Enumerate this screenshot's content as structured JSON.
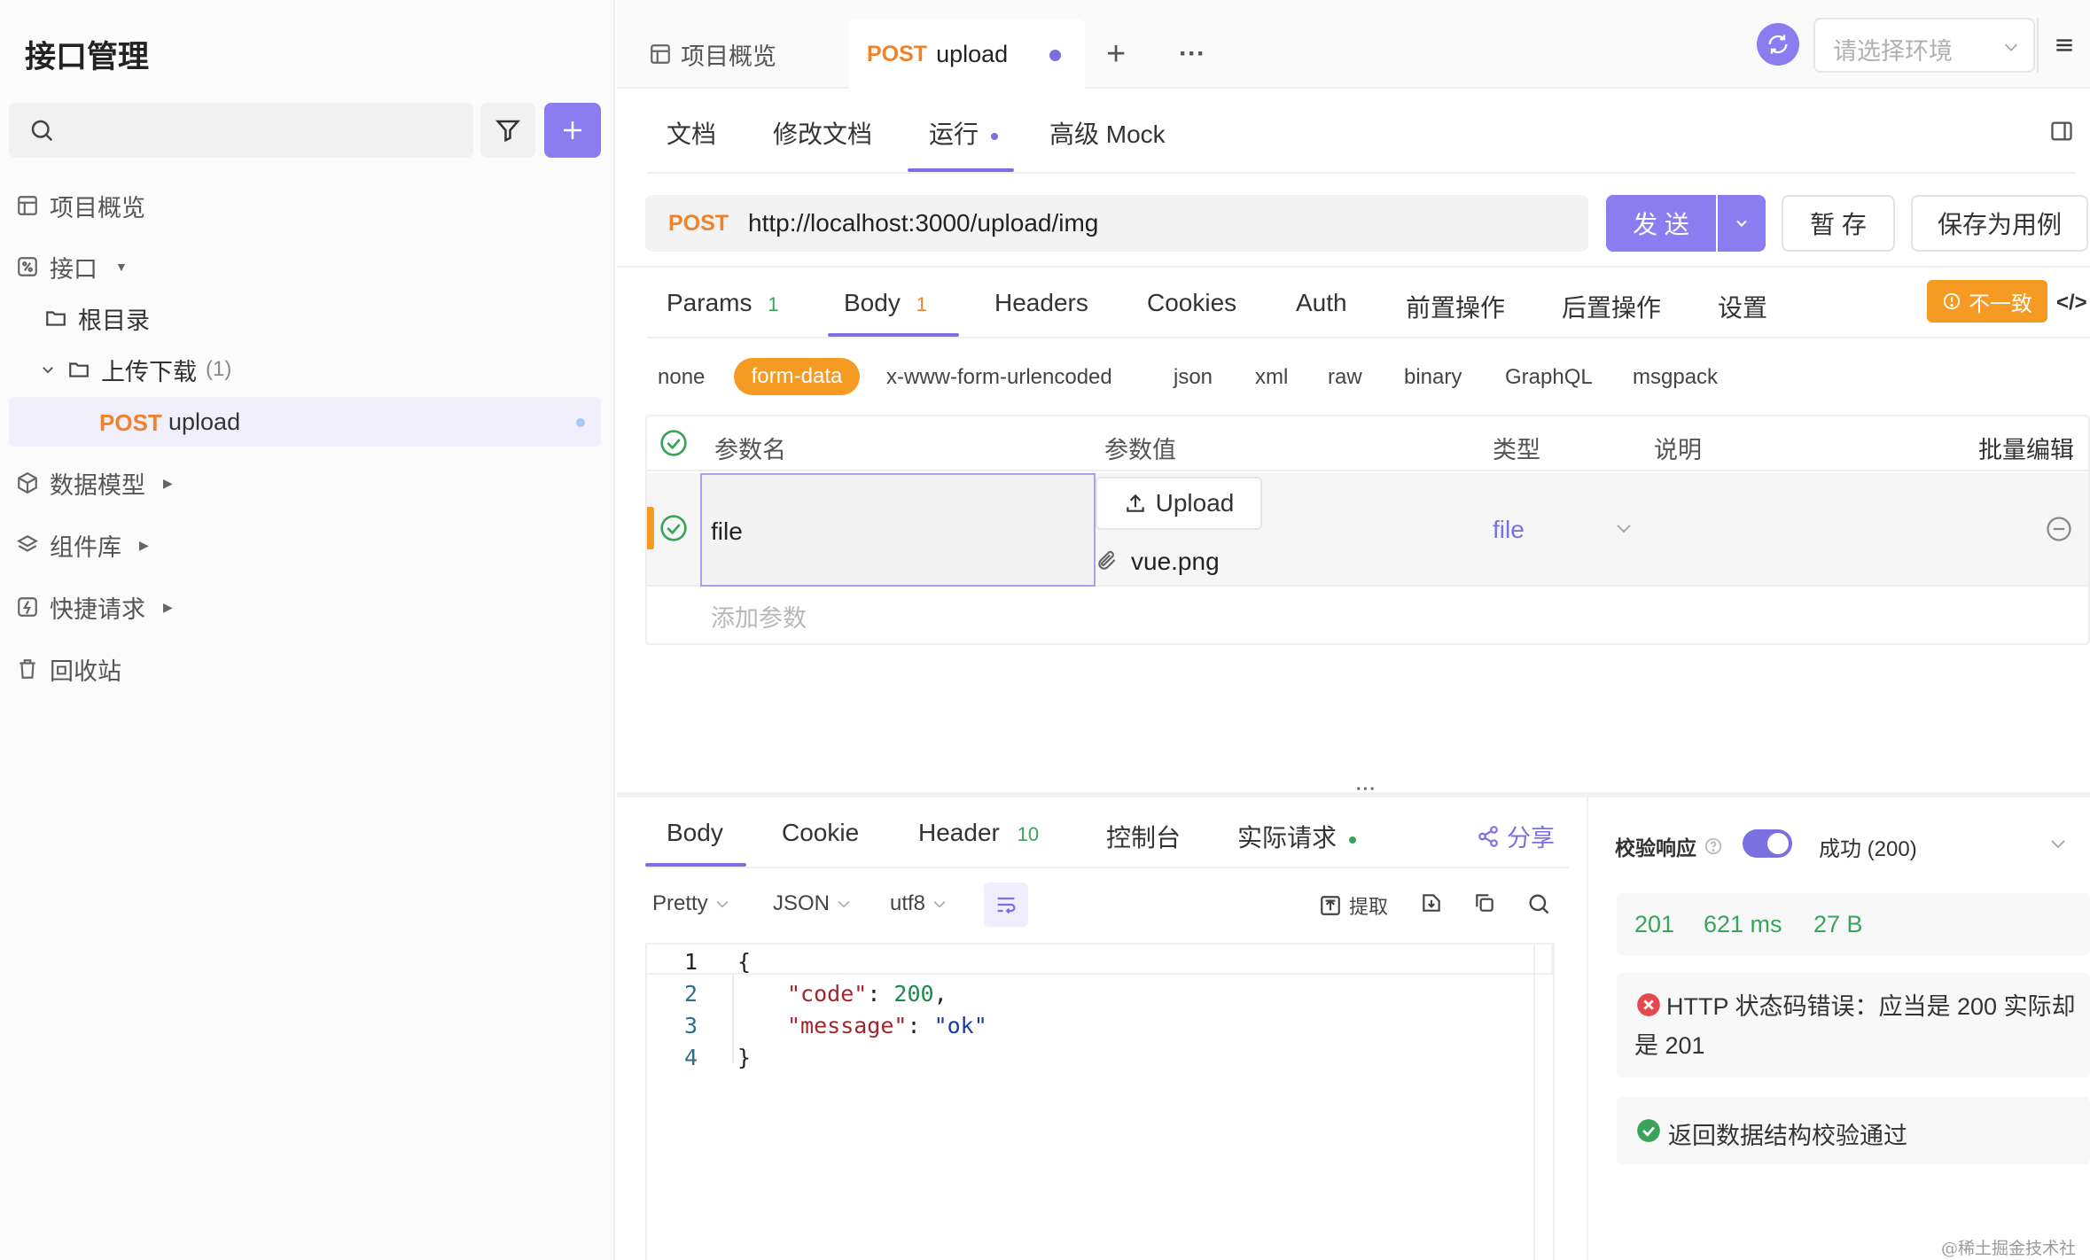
{
  "sidebar": {
    "title": "接口管理",
    "items": [
      {
        "label": "项目概览"
      },
      {
        "label": "接口"
      },
      {
        "label": "根目录"
      },
      {
        "label": "上传下载",
        "count": "(1)"
      },
      {
        "method": "POST",
        "label": "upload"
      },
      {
        "label": "数据模型"
      },
      {
        "label": "组件库"
      },
      {
        "label": "快捷请求"
      },
      {
        "label": "回收站"
      }
    ]
  },
  "tabs": {
    "overview": "项目概览",
    "active_method": "POST",
    "active_name": "upload",
    "add": "+",
    "more": "···"
  },
  "env": {
    "placeholder": "请选择环境"
  },
  "subtabs": [
    "文档",
    "修改文档",
    "运行",
    "高级 Mock"
  ],
  "request": {
    "method": "POST",
    "url": "http://localhost:3000/upload/img",
    "send": "发 送",
    "save": "暂 存",
    "save_case": "保存为用例"
  },
  "param_tabs": [
    {
      "label": "Params",
      "count": "1"
    },
    {
      "label": "Body",
      "count": "1"
    },
    {
      "label": "Headers"
    },
    {
      "label": "Cookies"
    },
    {
      "label": "Auth"
    },
    {
      "label": "前置操作"
    },
    {
      "label": "后置操作"
    },
    {
      "label": "设置"
    }
  ],
  "inconsistent": "不一致",
  "code_toggle": "</>",
  "body_types": [
    "none",
    "form-data",
    "x-www-form-urlencoded",
    "json",
    "xml",
    "raw",
    "binary",
    "GraphQL",
    "msgpack"
  ],
  "table": {
    "headers": {
      "name": "参数名",
      "value": "参数值",
      "type": "类型",
      "desc": "说明",
      "bulk": "批量编辑"
    },
    "row": {
      "name": "file",
      "upload": "Upload",
      "file": "vue.png",
      "type": "file"
    },
    "add_placeholder": "添加参数"
  },
  "response": {
    "tabs": [
      {
        "label": "Body"
      },
      {
        "label": "Cookie"
      },
      {
        "label": "Header",
        "count": "10"
      },
      {
        "label": "控制台"
      },
      {
        "label": "实际请求"
      }
    ],
    "share": "分享",
    "format": "Pretty",
    "lang": "JSON",
    "encoding": "utf8",
    "extract": "提取",
    "code_lines": [
      "1",
      "2",
      "3",
      "4"
    ],
    "code": {
      "l1": "{",
      "key1": "\"code\"",
      "val1": "200",
      "key2": "\"message\"",
      "val2": "\"ok\"",
      "l4": "}"
    }
  },
  "validation": {
    "label": "校验响应",
    "status": "成功 (200)",
    "code": "201",
    "time": "621 ms",
    "size": "27 B",
    "error": "HTTP 状态码错误：应当是 200 实际却是 201",
    "success": "返回数据结构校验通过"
  },
  "watermark": "@稀土掘金技术社区",
  "colors": {
    "accent": "#7c6fe0",
    "method": "#f0822a",
    "success": "#3aa35b",
    "error": "#e5484d"
  }
}
